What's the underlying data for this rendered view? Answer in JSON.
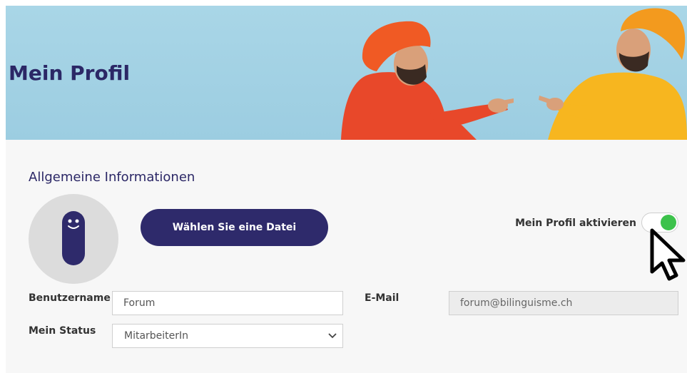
{
  "header": {
    "title": "Mein Profil"
  },
  "section": {
    "title": "Allgemeine Informationen"
  },
  "upload": {
    "button_label": "Wählen Sie eine Datei"
  },
  "activate": {
    "label": "Mein Profil aktivieren",
    "enabled": true
  },
  "form": {
    "username": {
      "label": "Benutzername",
      "value": "Forum"
    },
    "email": {
      "label": "E-Mail",
      "value": "forum@bilinguisme.ch"
    },
    "status": {
      "label": "Mein Status",
      "selected": "MitarbeiterIn"
    }
  },
  "colors": {
    "brand": "#2e2a6b",
    "toggle_on": "#3cc24b",
    "banner_bg": "#a9d6e7"
  }
}
